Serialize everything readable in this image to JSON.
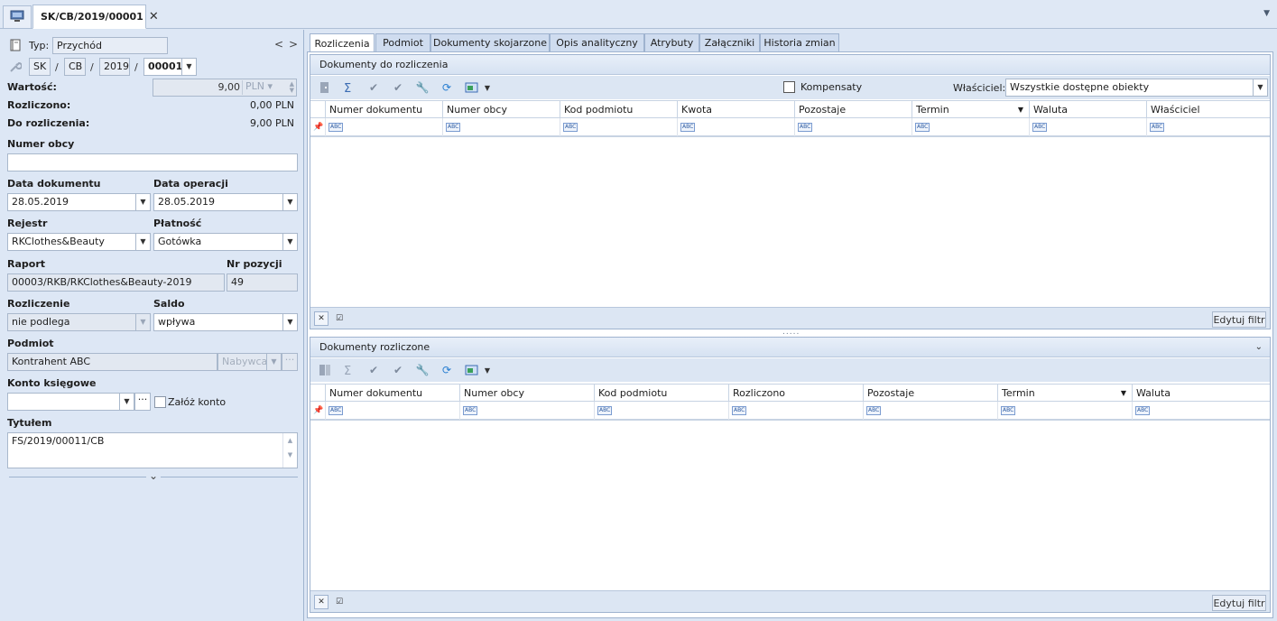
{
  "window": {
    "tab_title": "SK/CB/2019/00001",
    "close_symbol": "✕",
    "menu_arrow": "▼"
  },
  "left": {
    "typ_label": "Typ:",
    "typ_value": "Przychód",
    "nav_prev": "<",
    "nav_next": ">",
    "number": {
      "p1": "SK",
      "p2": "CB",
      "p3": "2019",
      "p4": "00001",
      "sep": "/"
    },
    "wartosc_label": "Wartość:",
    "wartosc_value": "9,00",
    "wartosc_currency": "PLN",
    "rozliczono_label": "Rozliczono:",
    "rozliczono_value": "0,00 PLN",
    "do_rozliczenia_label": "Do rozliczenia:",
    "do_rozliczenia_value": "9,00 PLN",
    "numer_obcy_label": "Numer obcy",
    "numer_obcy_value": "",
    "data_dokumentu_label": "Data dokumentu",
    "data_dokumentu_value": "28.05.2019",
    "data_operacji_label": "Data operacji",
    "data_operacji_value": "28.05.2019",
    "rejestr_label": "Rejestr",
    "rejestr_value": "RKClothes&Beauty",
    "platnosc_label": "Płatność",
    "platnosc_value": "Gotówka",
    "raport_label": "Raport",
    "raport_value": "00003/RKB/RKClothes&Beauty-2019",
    "nr_pozycji_label": "Nr pozycji",
    "nr_pozycji_value": "49",
    "rozliczenie_label": "Rozliczenie",
    "rozliczenie_value": "nie podlega",
    "saldo_label": "Saldo",
    "saldo_value": "wpływa",
    "podmiot_label": "Podmiot",
    "podmiot_value": "Kontrahent ABC",
    "podmiot_type": "Nabywca",
    "konto_label": "Konto księgowe",
    "konto_value": "",
    "zaloz_konto_label": "Załóż konto",
    "tytulem_label": "Tytułem",
    "tytulem_value": "FS/2019/00011/CB",
    "ellipsis": "···",
    "collapse": "⌄"
  },
  "tabs": [
    "Rozliczenia",
    "Podmiot",
    "Dokumenty skojarzone",
    "Opis analityczny",
    "Atrybuty",
    "Załączniki",
    "Historia zmian"
  ],
  "section1": {
    "title": "Dokumenty do rozliczenia",
    "kompensaty_label": "Kompensaty",
    "wlasciciel_label": "Właściciel:",
    "wlasciciel_value": "Wszystkie dostępne obiekty",
    "columns": [
      "Numer dokumentu",
      "Numer obcy",
      "Kod podmiotu",
      "Kwota",
      "Pozostaje",
      "Termin",
      "Waluta",
      "Właściciel"
    ],
    "edit_filter": "Edytuj filtr",
    "abc": "ABC"
  },
  "section2": {
    "title": "Dokumenty rozliczone",
    "columns": [
      "Numer dokumentu",
      "Numer obcy",
      "Kod podmiotu",
      "Rozliczono",
      "Pozostaje",
      "Termin",
      "Waluta"
    ],
    "edit_filter": "Edytuj filtr",
    "abc": "ABC"
  },
  "splitter": "....."
}
